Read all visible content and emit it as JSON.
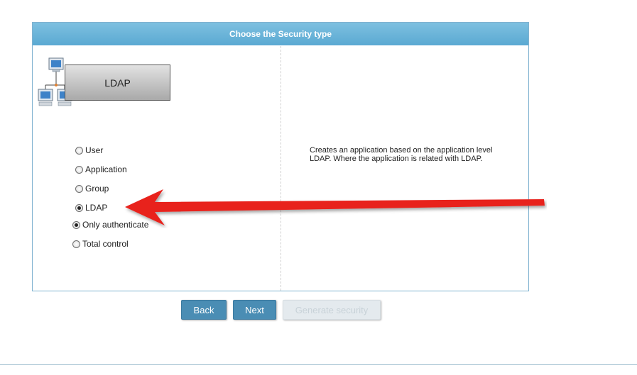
{
  "panel": {
    "title": "Choose the Security type"
  },
  "selected_type": {
    "label": "LDAP",
    "icon": "network-computers-icon"
  },
  "security_types": [
    {
      "label": "User",
      "checked": false
    },
    {
      "label": "Application",
      "checked": false
    },
    {
      "label": "Group",
      "checked": false
    },
    {
      "label": "LDAP",
      "checked": true
    }
  ],
  "ldap_modes": [
    {
      "label": "Only authenticate",
      "checked": true
    },
    {
      "label": "Total control",
      "checked": false
    }
  ],
  "description": "Creates an application based on the application level LDAP. Where the application is related with LDAP.",
  "buttons": {
    "back": "Back",
    "next": "Next",
    "generate": "Generate security"
  },
  "colors": {
    "header": "#5aa9d2",
    "button": "#4a8db4",
    "annotation_arrow": "#e8201c"
  }
}
